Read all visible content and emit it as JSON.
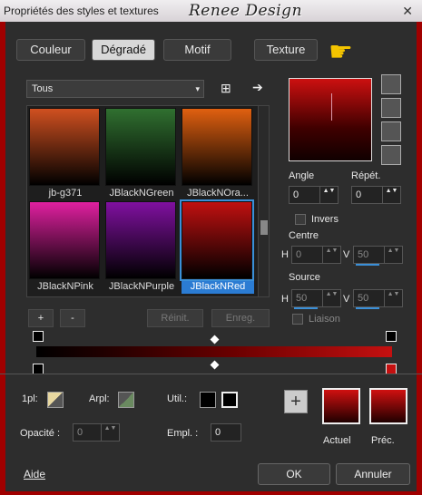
{
  "window": {
    "title": "Propriétés des styles et textures",
    "brand": "Renee Design",
    "close": "✕"
  },
  "tabs": [
    "Couleur",
    "Dégradé",
    "Motif",
    "Texture"
  ],
  "category": {
    "value": "Tous",
    "arrow": "▾"
  },
  "swatches": [
    {
      "label": "jb-g371",
      "top": "#d05020",
      "bottom": "#000000"
    },
    {
      "label": "JBlackNGreen",
      "top": "#307030",
      "bottom": "#000000"
    },
    {
      "label": "JBlackNOra...",
      "top": "#e06010",
      "bottom": "#000000"
    },
    {
      "label": "JBlackNPink",
      "top": "#e020a0",
      "bottom": "#000000"
    },
    {
      "label": "JBlackNPurple",
      "top": "#8010a0",
      "bottom": "#000000"
    },
    {
      "label": "JBlackNRed",
      "top": "#c01010",
      "bottom": "#000000"
    }
  ],
  "buttons": {
    "add": "+",
    "remove": "-",
    "reset": "Réinit.",
    "save": "Enreg.",
    "ok": "OK",
    "cancel": "Annuler",
    "help": "Aide"
  },
  "angle": {
    "label": "Angle",
    "value": "0"
  },
  "repeat": {
    "label": "Répét.",
    "value": "0"
  },
  "invert": {
    "label": "Invers"
  },
  "center": {
    "label": "Centre",
    "h_label": "H",
    "h": "0",
    "v_label": "V",
    "v": "50"
  },
  "source": {
    "label": "Source",
    "h_label": "H",
    "h": "50",
    "v_label": "V",
    "v": "50"
  },
  "link": {
    "label": "Liaison"
  },
  "bottom": {
    "ipl": "1pl:",
    "arpl": "Arpl:",
    "util": "Util.:",
    "opacity": "Opacité :",
    "opacity_value": "0",
    "empl": "Empl. :",
    "empl_value": "0"
  },
  "swatch_labels": {
    "current": "Actuel",
    "previous": "Préc."
  },
  "icons": {
    "browse": "⊞",
    "next": "➔",
    "spin": "▲▼"
  }
}
